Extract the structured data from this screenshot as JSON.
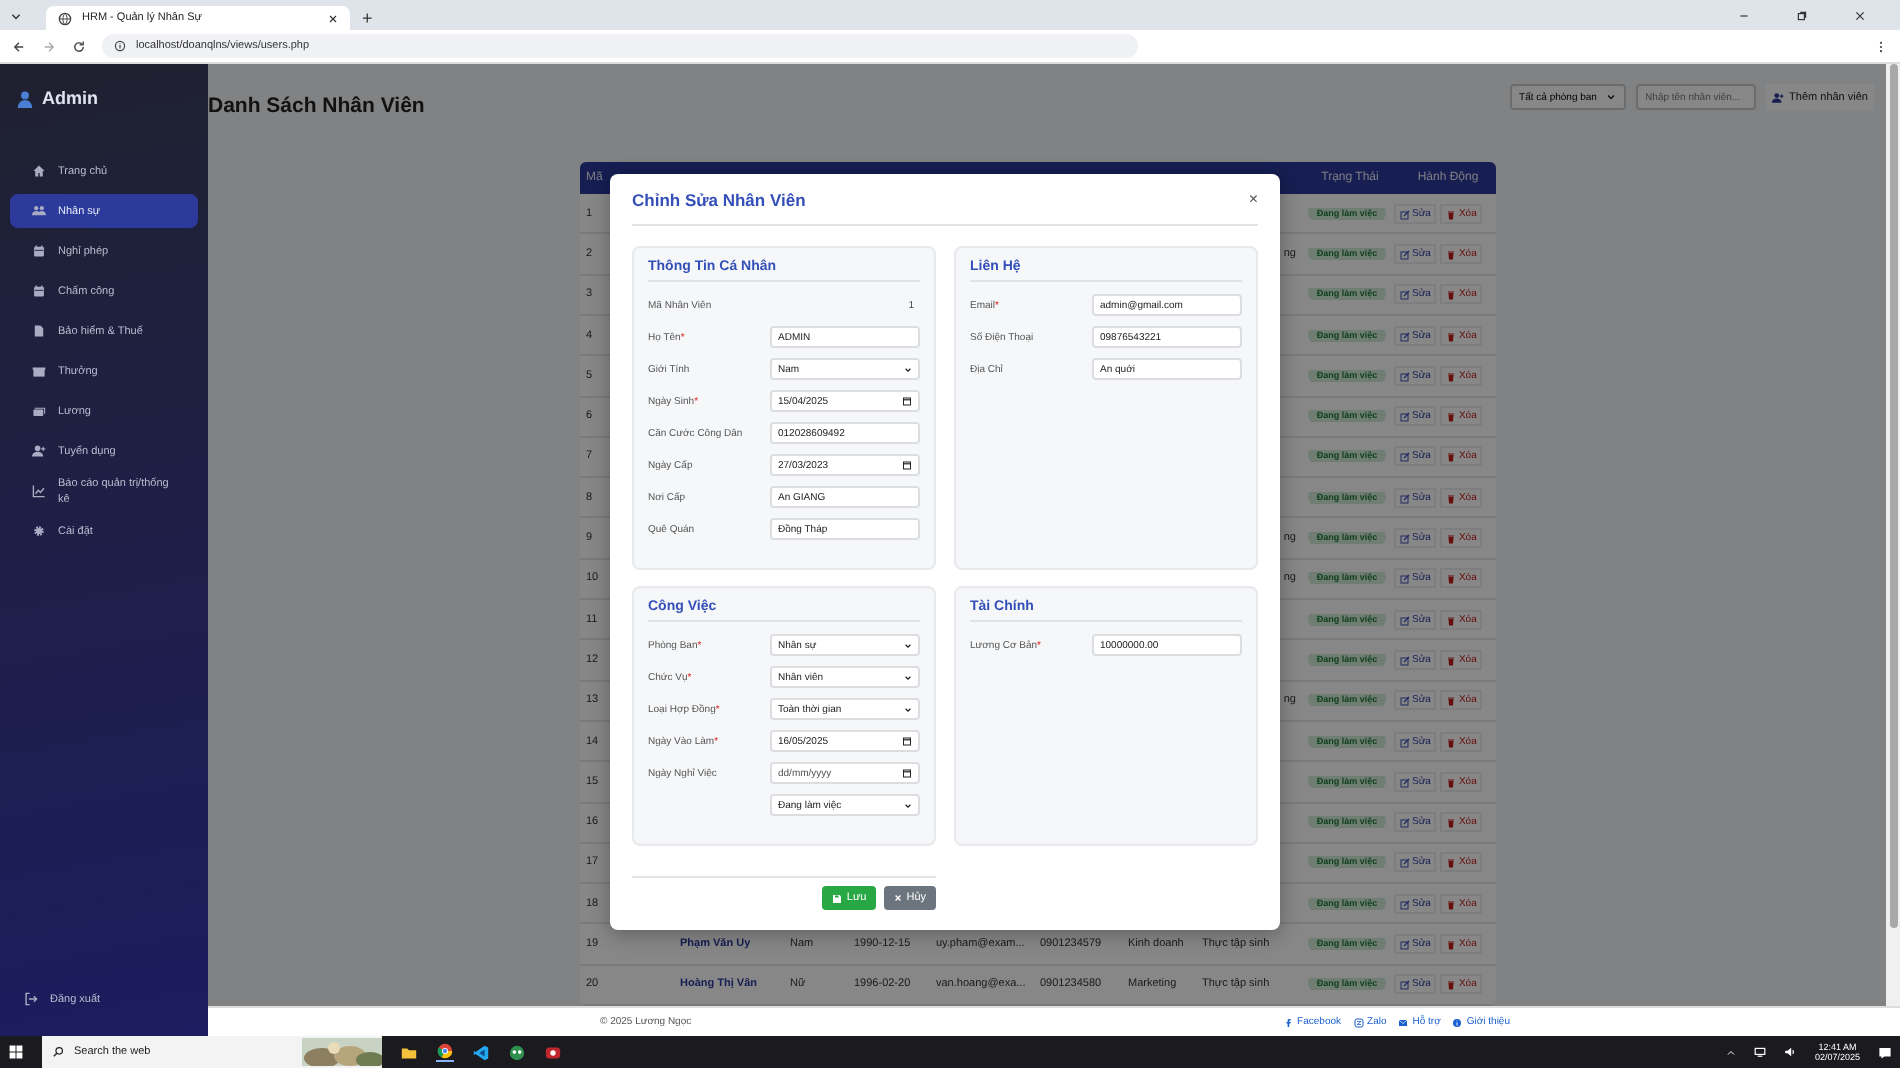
{
  "browser": {
    "tab_title": "HRM - Quản lý Nhân Sự",
    "new_tab": "+",
    "address": "localhost/doanqlns/views/users.php"
  },
  "sidebar": {
    "brand": "Admin",
    "items": [
      {
        "label": "Trang chủ",
        "selected": false
      },
      {
        "label": "Nhân sự",
        "selected": true
      },
      {
        "label": "Nghỉ phép",
        "selected": false
      },
      {
        "label": "Chấm công",
        "selected": false
      },
      {
        "label": "Bảo hiểm & Thuế",
        "selected": false
      },
      {
        "label": "Thưởng",
        "selected": false
      },
      {
        "label": "Lương",
        "selected": false
      },
      {
        "label": "Tuyển dụng",
        "selected": false
      },
      {
        "label": "Báo cáo quản trị/thống kê",
        "selected": false
      },
      {
        "label": "Cài đặt",
        "selected": false
      }
    ],
    "logout": "Đăng xuất"
  },
  "header": {
    "title": "Danh Sách Nhân Viên",
    "department_filter": "Tất cả phòng ban",
    "search_placeholder": "Nhập tên nhân viên...",
    "add_button": "Thêm nhân viên"
  },
  "table": {
    "columns": {
      "id": "Mã",
      "status": "Trạng Thái",
      "actions": "Hành Động"
    },
    "rows": [
      {
        "id": "1",
        "status": "Đang làm việc",
        "edit": "Sửa",
        "delete": "Xóa"
      },
      {
        "id": "2",
        "position": "ng",
        "position_clipped": true,
        "status": "Đang làm việc",
        "edit": "Sửa",
        "delete": "Xóa"
      },
      {
        "id": "3",
        "status": "Đang làm việc",
        "edit": "Sửa",
        "delete": "Xóa"
      },
      {
        "id": "4",
        "status": "Đang làm việc",
        "edit": "Sửa",
        "delete": "Xóa"
      },
      {
        "id": "5",
        "status": "Đang làm việc",
        "edit": "Sửa",
        "delete": "Xóa"
      },
      {
        "id": "6",
        "status": "Đang làm việc",
        "edit": "Sửa",
        "delete": "Xóa"
      },
      {
        "id": "7",
        "status": "Đang làm việc",
        "edit": "Sửa",
        "delete": "Xóa"
      },
      {
        "id": "8",
        "status": "Đang làm việc",
        "edit": "Sửa",
        "delete": "Xóa"
      },
      {
        "id": "9",
        "position": "ng",
        "position_clipped": true,
        "status": "Đang làm việc",
        "edit": "Sửa",
        "delete": "Xóa"
      },
      {
        "id": "10",
        "position": "ng",
        "position_clipped": true,
        "status": "Đang làm việc",
        "edit": "Sửa",
        "delete": "Xóa"
      },
      {
        "id": "11",
        "status": "Đang làm việc",
        "edit": "Sửa",
        "delete": "Xóa"
      },
      {
        "id": "12",
        "status": "Đang làm việc",
        "edit": "Sửa",
        "delete": "Xóa"
      },
      {
        "id": "13",
        "position": "ng",
        "position_clipped": true,
        "status": "Đang làm việc",
        "edit": "Sửa",
        "delete": "Xóa"
      },
      {
        "id": "14",
        "status": "Đang làm việc",
        "edit": "Sửa",
        "delete": "Xóa"
      },
      {
        "id": "15",
        "status": "Đang làm việc",
        "edit": "Sửa",
        "delete": "Xóa"
      },
      {
        "id": "16",
        "status": "Đang làm việc",
        "edit": "Sửa",
        "delete": "Xóa"
      },
      {
        "id": "17",
        "status": "Đang làm việc",
        "edit": "Sửa",
        "delete": "Xóa"
      },
      {
        "id": "18",
        "status": "Đang làm việc",
        "edit": "Sửa",
        "delete": "Xóa"
      },
      {
        "id": "19",
        "name": "Phạm Văn Uy",
        "gender": "Nam",
        "dob": "1990-12-15",
        "email": "uy.pham@exam...",
        "phone": "0901234579",
        "department": "Kinh doanh",
        "position": "Thực tập sinh",
        "status": "Đang làm việc",
        "edit": "Sửa",
        "delete": "Xóa"
      },
      {
        "id": "20",
        "name": "Hoàng Thị Vân",
        "gender": "Nữ",
        "dob": "1996-02-20",
        "email": "van.hoang@exa...",
        "phone": "0901234580",
        "department": "Marketing",
        "position": "Thực tập sinh",
        "status": "Đang làm việc",
        "edit": "Sửa",
        "delete": "Xóa"
      }
    ]
  },
  "modal": {
    "title": "Chỉnh Sửa Nhân Viên",
    "close": "×",
    "sections": [
      {
        "title": "Thông Tin Cá Nhân",
        "fields": [
          {
            "label": "Mã Nhân Viên",
            "kind": "static",
            "value": "1"
          },
          {
            "label": "Họ Tên",
            "required_mark": "*",
            "kind": "text",
            "value": "ADMIN"
          },
          {
            "label": "Giới Tính",
            "kind": "select",
            "value": "Nam"
          },
          {
            "label": "Ngày Sinh",
            "required_mark": "*",
            "kind": "date",
            "value": "15/04/2025"
          },
          {
            "label": "Căn Cước Công Dân",
            "kind": "text",
            "value": "012028609492"
          },
          {
            "label": "Ngày Cấp",
            "kind": "date",
            "value": "27/03/2023"
          },
          {
            "label": "Nơi Cấp",
            "kind": "text",
            "value": "An GIANG"
          },
          {
            "label": "Quê Quán",
            "kind": "text",
            "value": "Đồng Tháp"
          }
        ]
      },
      {
        "title": "Liên Hệ",
        "fields": [
          {
            "label": "Email",
            "required_mark": "*",
            "kind": "text",
            "value": "admin@gmail.com"
          },
          {
            "label": "Số Điện Thoại",
            "kind": "text",
            "value": "09876543221"
          },
          {
            "label": "Địa Chỉ",
            "kind": "text",
            "value": "An quới"
          }
        ]
      },
      {
        "title": "Công Việc",
        "fields": [
          {
            "label": "Phòng Ban",
            "required_mark": "*",
            "kind": "select",
            "value": "Nhân sự"
          },
          {
            "label": "Chức Vụ",
            "required_mark": "*",
            "kind": "select",
            "value": "Nhân viên"
          },
          {
            "label": "Loại Hợp Đồng",
            "required_mark": "*",
            "kind": "select",
            "value": "Toàn thời gian"
          },
          {
            "label": "Ngày Vào Làm",
            "required_mark": "*",
            "kind": "date",
            "value": "16/05/2025"
          },
          {
            "label": "Ngày Nghỉ Việc",
            "kind": "date",
            "placeholder": "dd/mm/yyyy"
          },
          {
            "kind": "select",
            "value": "Đang làm việc"
          }
        ]
      },
      {
        "title": "Tài Chính",
        "fields": [
          {
            "label": "Lương Cơ Bản",
            "required_mark": "*",
            "kind": "text",
            "value": "10000000.00"
          }
        ]
      }
    ],
    "buttons": [
      {
        "label": "Lưu",
        "kind": "primary"
      },
      {
        "label": "Hủy",
        "kind": "secondary"
      }
    ]
  },
  "footer": {
    "copyright": "© 2025 Lương Ngọc",
    "links": [
      "Facebook",
      "Zalo",
      "Hỗ trợ",
      "Giới thiệu"
    ]
  },
  "taskbar": {
    "search_placeholder": "Search the web",
    "time": "12:41 AM",
    "date": "02/07/2025"
  }
}
